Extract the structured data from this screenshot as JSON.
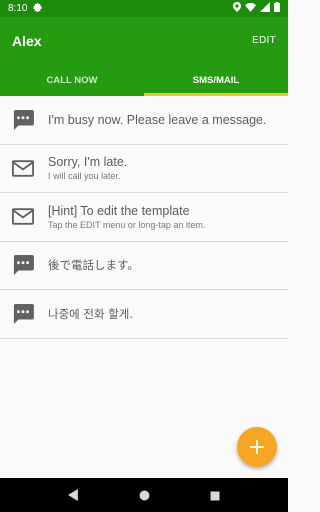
{
  "status_bar": {
    "time": "8:10",
    "icons": [
      "gear-icon",
      "location-icon",
      "wifi-icon",
      "signal-icon",
      "battery-icon"
    ]
  },
  "app_bar": {
    "title": "Alex",
    "edit_label": "EDIT"
  },
  "tabs": [
    {
      "label": "CALL NOW",
      "active": false
    },
    {
      "label": "SMS/MAIL",
      "active": true
    }
  ],
  "messages": [
    {
      "icon": "sms-icon",
      "text": "I'm busy now. Please leave a message.",
      "sub": ""
    },
    {
      "icon": "mail-icon",
      "text": "Sorry, I'm late.",
      "sub": "I will call you later."
    },
    {
      "icon": "mail-icon",
      "text": "[Hint] To edit the template",
      "sub": "Tap the EDIT menu or long-tap an item."
    },
    {
      "icon": "sms-icon",
      "text": "後で電話します。",
      "sub": ""
    },
    {
      "icon": "sms-icon",
      "text": "나중에 전화 할게.",
      "sub": ""
    }
  ],
  "fab": {
    "label": "+",
    "icon": "add-icon"
  },
  "nav": {
    "icons": [
      "back-icon",
      "home-icon",
      "recents-icon"
    ]
  },
  "colors": {
    "primary": "#259b11",
    "status": "#1e8a0e",
    "accent": "#f4c40f",
    "fab": "#f5a623"
  }
}
